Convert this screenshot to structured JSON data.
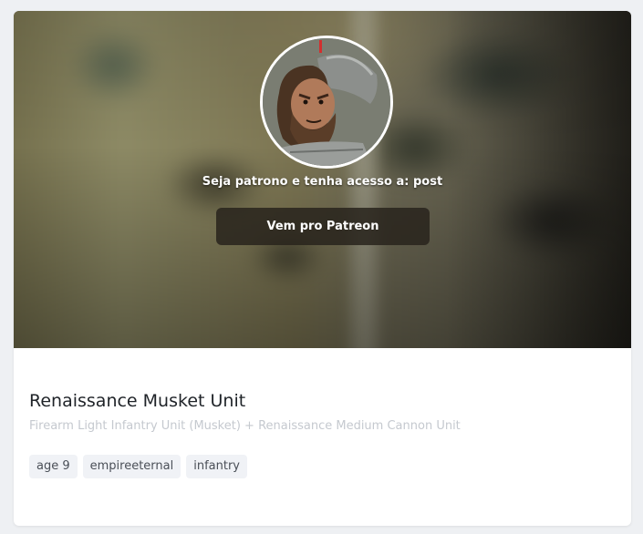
{
  "hero": {
    "avatar_alt": "avatar",
    "patron_text": "Seja patrono e tenha acesso a: post",
    "button_label": "Vem pro Patreon"
  },
  "post": {
    "title": "Renaissance Musket Unit",
    "subtitle": "Firearm Light Infantry Unit (Musket) + Renaissance Medium Cannon Unit"
  },
  "tags": [
    "age 9",
    "empireeternal",
    "infantry"
  ]
}
